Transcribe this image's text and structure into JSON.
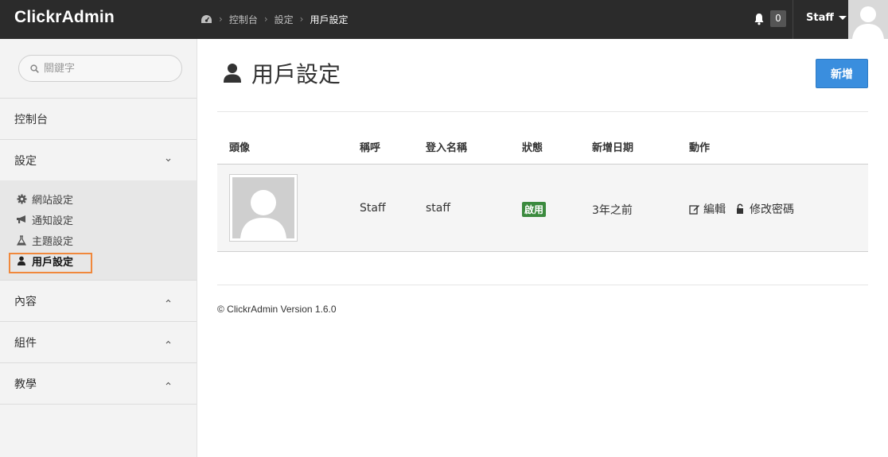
{
  "app": {
    "brand": "ClickrAdmin"
  },
  "breadcrumb": [
    "控制台",
    "設定",
    "用戶設定"
  ],
  "header": {
    "notification_count": "0",
    "user_menu_label": "Staff"
  },
  "sidebar": {
    "search_placeholder": "關鍵字",
    "items": [
      {
        "label": "控制台"
      },
      {
        "label": "設定",
        "expanded": true
      },
      {
        "label": "內容"
      },
      {
        "label": "組件"
      },
      {
        "label": "教學"
      }
    ],
    "sub_items": [
      {
        "label": "網站設定",
        "icon": "gear-icon"
      },
      {
        "label": "通知設定",
        "icon": "bullhorn-icon"
      },
      {
        "label": "主題設定",
        "icon": "flask-icon"
      },
      {
        "label": "用戶設定",
        "icon": "user-icon",
        "active": true
      }
    ]
  },
  "main": {
    "title": "用戶設定",
    "add_button": "新增",
    "table": {
      "headers": [
        "頭像",
        "稱呼",
        "登入名稱",
        "狀態",
        "新增日期",
        "動作"
      ],
      "rows": [
        {
          "name": "Staff",
          "login": "staff",
          "status": "啟用",
          "created": "3年之前",
          "actions": [
            "編輯",
            "修改密碼"
          ]
        }
      ]
    }
  },
  "footer": {
    "text": "© ClickrAdmin Version 1.6.0"
  },
  "colors": {
    "topbar": "#2b2b2b",
    "primary": "#3a8ede",
    "success": "#3b8a3e",
    "highlight": "#f0883c"
  }
}
